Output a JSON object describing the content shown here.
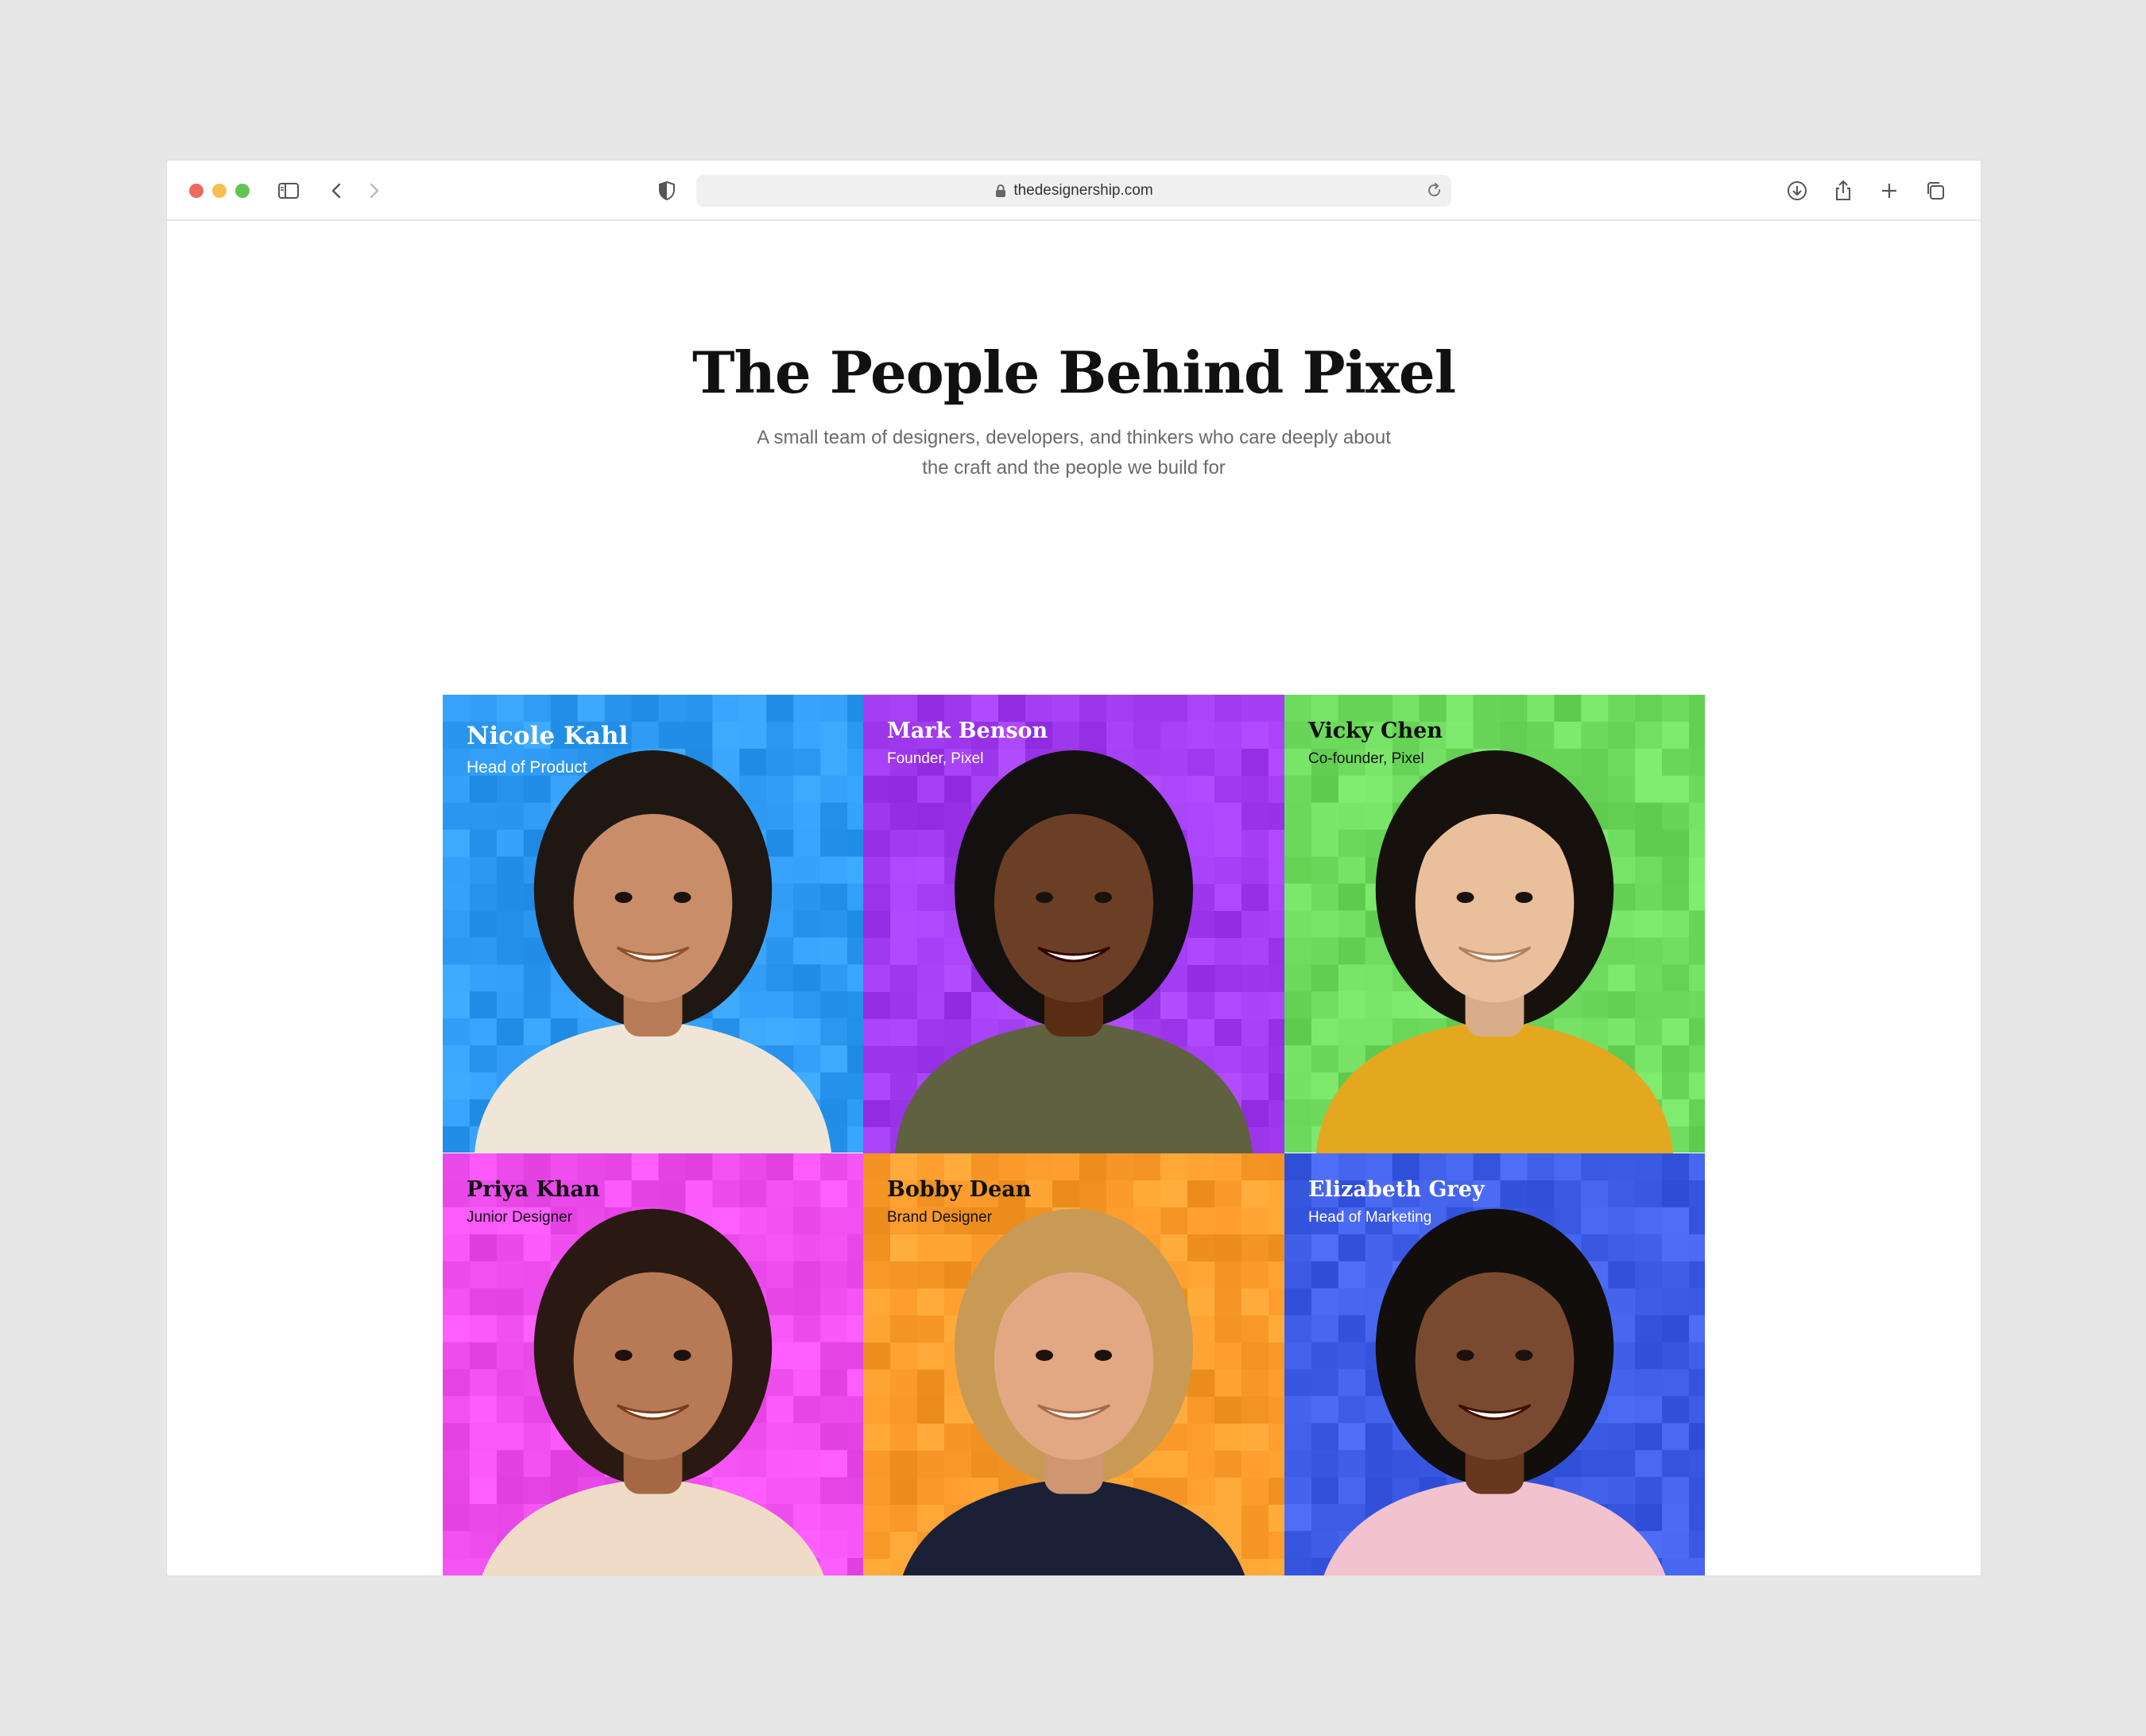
{
  "browser": {
    "url": "thedesignership.com",
    "icons": [
      "sidebar-icon",
      "back-icon",
      "forward-icon",
      "shield-icon",
      "lock-icon",
      "reload-icon",
      "download-icon",
      "share-icon",
      "new-tab-icon",
      "tabs-overview-icon"
    ]
  },
  "page": {
    "title": "The People Behind Pixel",
    "subtitle": "A small team of designers, developers, and thinkers who care deeply about the craft and the people we build for"
  },
  "team": [
    {
      "name": "Nicole Kahl",
      "role": "Head of Product",
      "bg": "#2f9bf5",
      "text_color": "#ffffff",
      "skin": "#c98d6a",
      "hair": "#1f1712",
      "shirt": "#efe6d8"
    },
    {
      "name": "Mark Benson",
      "role": "Founder, Pixel",
      "bg": "#a23cf0",
      "text_color": "#ffffff",
      "skin": "#6b3f26",
      "hair": "#141010",
      "shirt": "#5f6141"
    },
    {
      "name": "Vicky Chen",
      "role": "Co-founder, Pixel",
      "bg": "#6fdc5f",
      "text_color": "#111111",
      "skin": "#e9bf9c",
      "hair": "#17110e",
      "shirt": "#e3a820"
    },
    {
      "name": "Priya Khan",
      "role": "Junior Designer",
      "bg": "#f04ff0",
      "text_color": "#111111",
      "skin": "#b87a56",
      "hair": "#2a1812",
      "shirt": "#f0dcc6"
    },
    {
      "name": "Bobby Dean",
      "role": "Brand Designer",
      "bg": "#fb9c2c",
      "text_color": "#111111",
      "skin": "#e2a884",
      "hair": "#c89a55",
      "shirt": "#1a2036"
    },
    {
      "name": "Elizabeth Grey",
      "role": "Head of Marketing",
      "bg": "#3f5ee8",
      "text_color": "#ffffff",
      "skin": "#7a4a30",
      "hair": "#120e0c",
      "shirt": "#f1c3cf"
    }
  ]
}
